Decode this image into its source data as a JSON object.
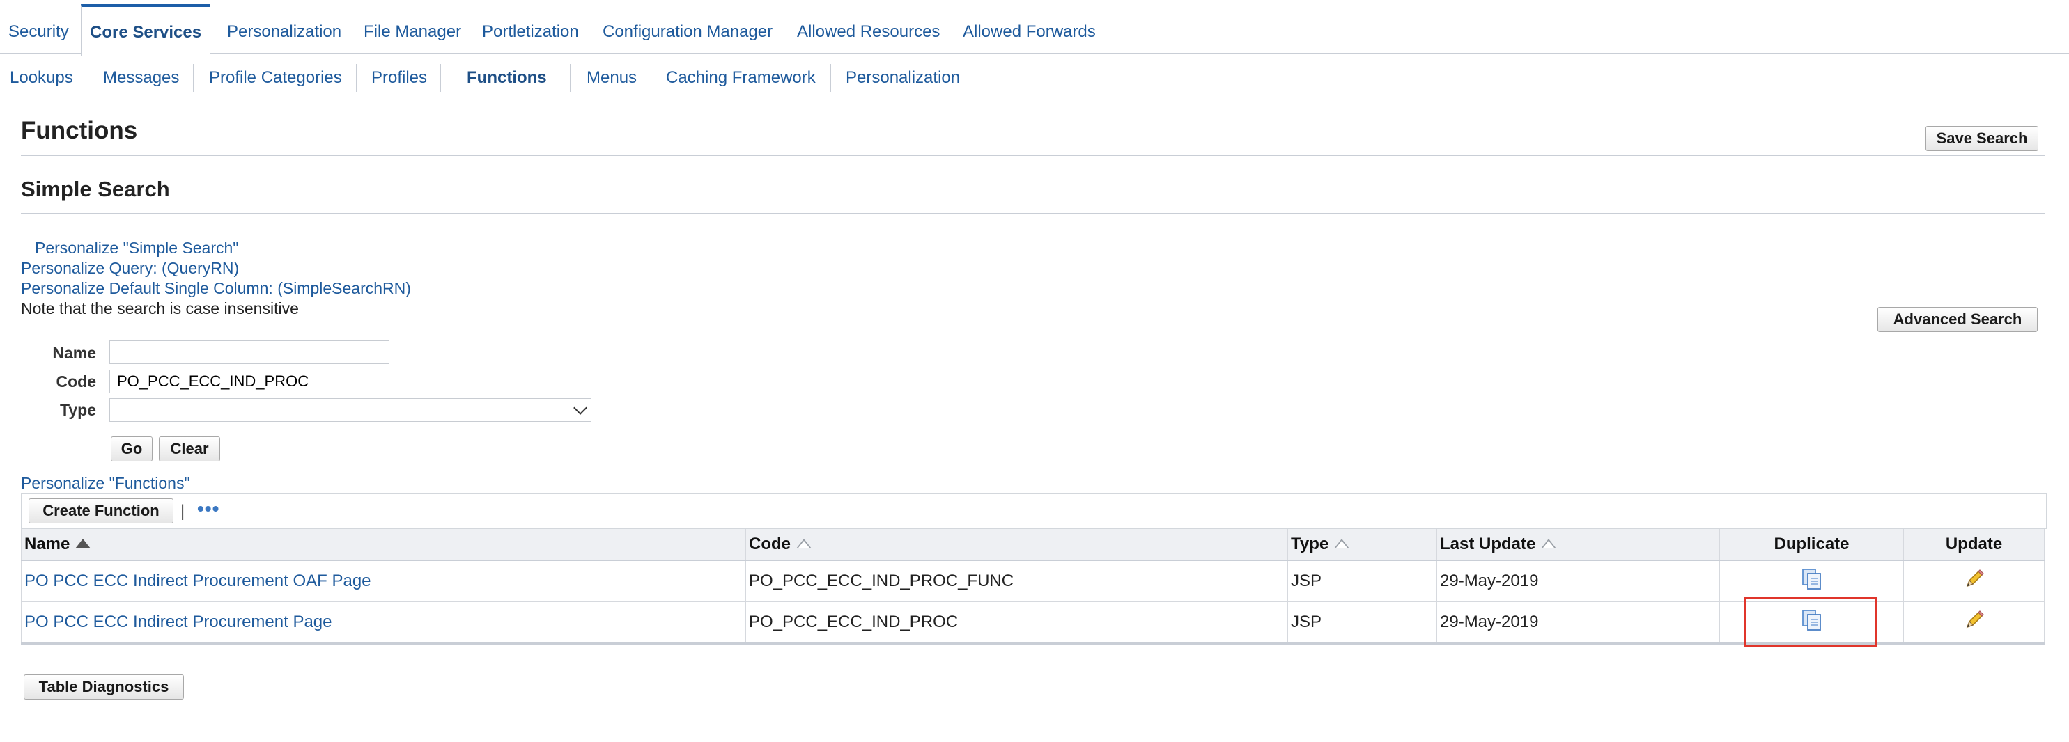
{
  "tabs": [
    {
      "label": "Security",
      "active": false
    },
    {
      "label": "Core Services",
      "active": true
    },
    {
      "label": "Personalization",
      "active": false
    },
    {
      "label": "File Manager",
      "active": false
    },
    {
      "label": "Portletization",
      "active": false
    },
    {
      "label": "Configuration Manager",
      "active": false
    },
    {
      "label": "Allowed Resources",
      "active": false
    },
    {
      "label": "Allowed Forwards",
      "active": false
    }
  ],
  "subtabs": [
    {
      "label": "Lookups",
      "active": false
    },
    {
      "label": "Messages",
      "active": false
    },
    {
      "label": "Profile Categories",
      "active": false
    },
    {
      "label": "Profiles",
      "active": false
    },
    {
      "label": "Functions",
      "active": true
    },
    {
      "label": "Menus",
      "active": false
    },
    {
      "label": "Caching Framework",
      "active": false
    },
    {
      "label": "Personalization",
      "active": false
    }
  ],
  "page": {
    "title": "Functions",
    "save_search_label": "Save Search",
    "section_title": "Simple Search",
    "personalize_simple_search": "Personalize \"Simple Search\"",
    "personalize_query": "Personalize Query: (QueryRN)",
    "personalize_column": "Personalize Default Single Column: (SimpleSearchRN)",
    "note": "Note that the search is case insensitive",
    "advanced_search_label": "Advanced Search"
  },
  "search": {
    "name_label": "Name",
    "name_value": "",
    "code_label": "Code",
    "code_value": "PO_PCC_ECC_IND_PROC",
    "type_label": "Type",
    "type_value": "",
    "go_label": "Go",
    "clear_label": "Clear"
  },
  "results": {
    "personalize_link": "Personalize \"Functions\"",
    "create_label": "Create Function",
    "more_label": "•••",
    "columns": {
      "name": "Name",
      "code": "Code",
      "type": "Type",
      "last_update": "Last Update",
      "duplicate": "Duplicate",
      "update": "Update"
    },
    "rows": [
      {
        "name": "PO PCC ECC Indirect Procurement OAF Page",
        "code": "PO_PCC_ECC_IND_PROC_FUNC",
        "type": "JSP",
        "last_update": "29-May-2019"
      },
      {
        "name": "PO PCC ECC Indirect Procurement Page",
        "code": "PO_PCC_ECC_IND_PROC",
        "type": "JSP",
        "last_update": "29-May-2019"
      }
    ],
    "diagnostics_label": "Table Diagnostics"
  },
  "icons": {
    "duplicate": "duplicate-icon",
    "update": "pencil-icon"
  },
  "colors": {
    "link": "#1e5a9c",
    "active_tab_border": "#1d5ea8",
    "highlight": "#e0352b"
  }
}
